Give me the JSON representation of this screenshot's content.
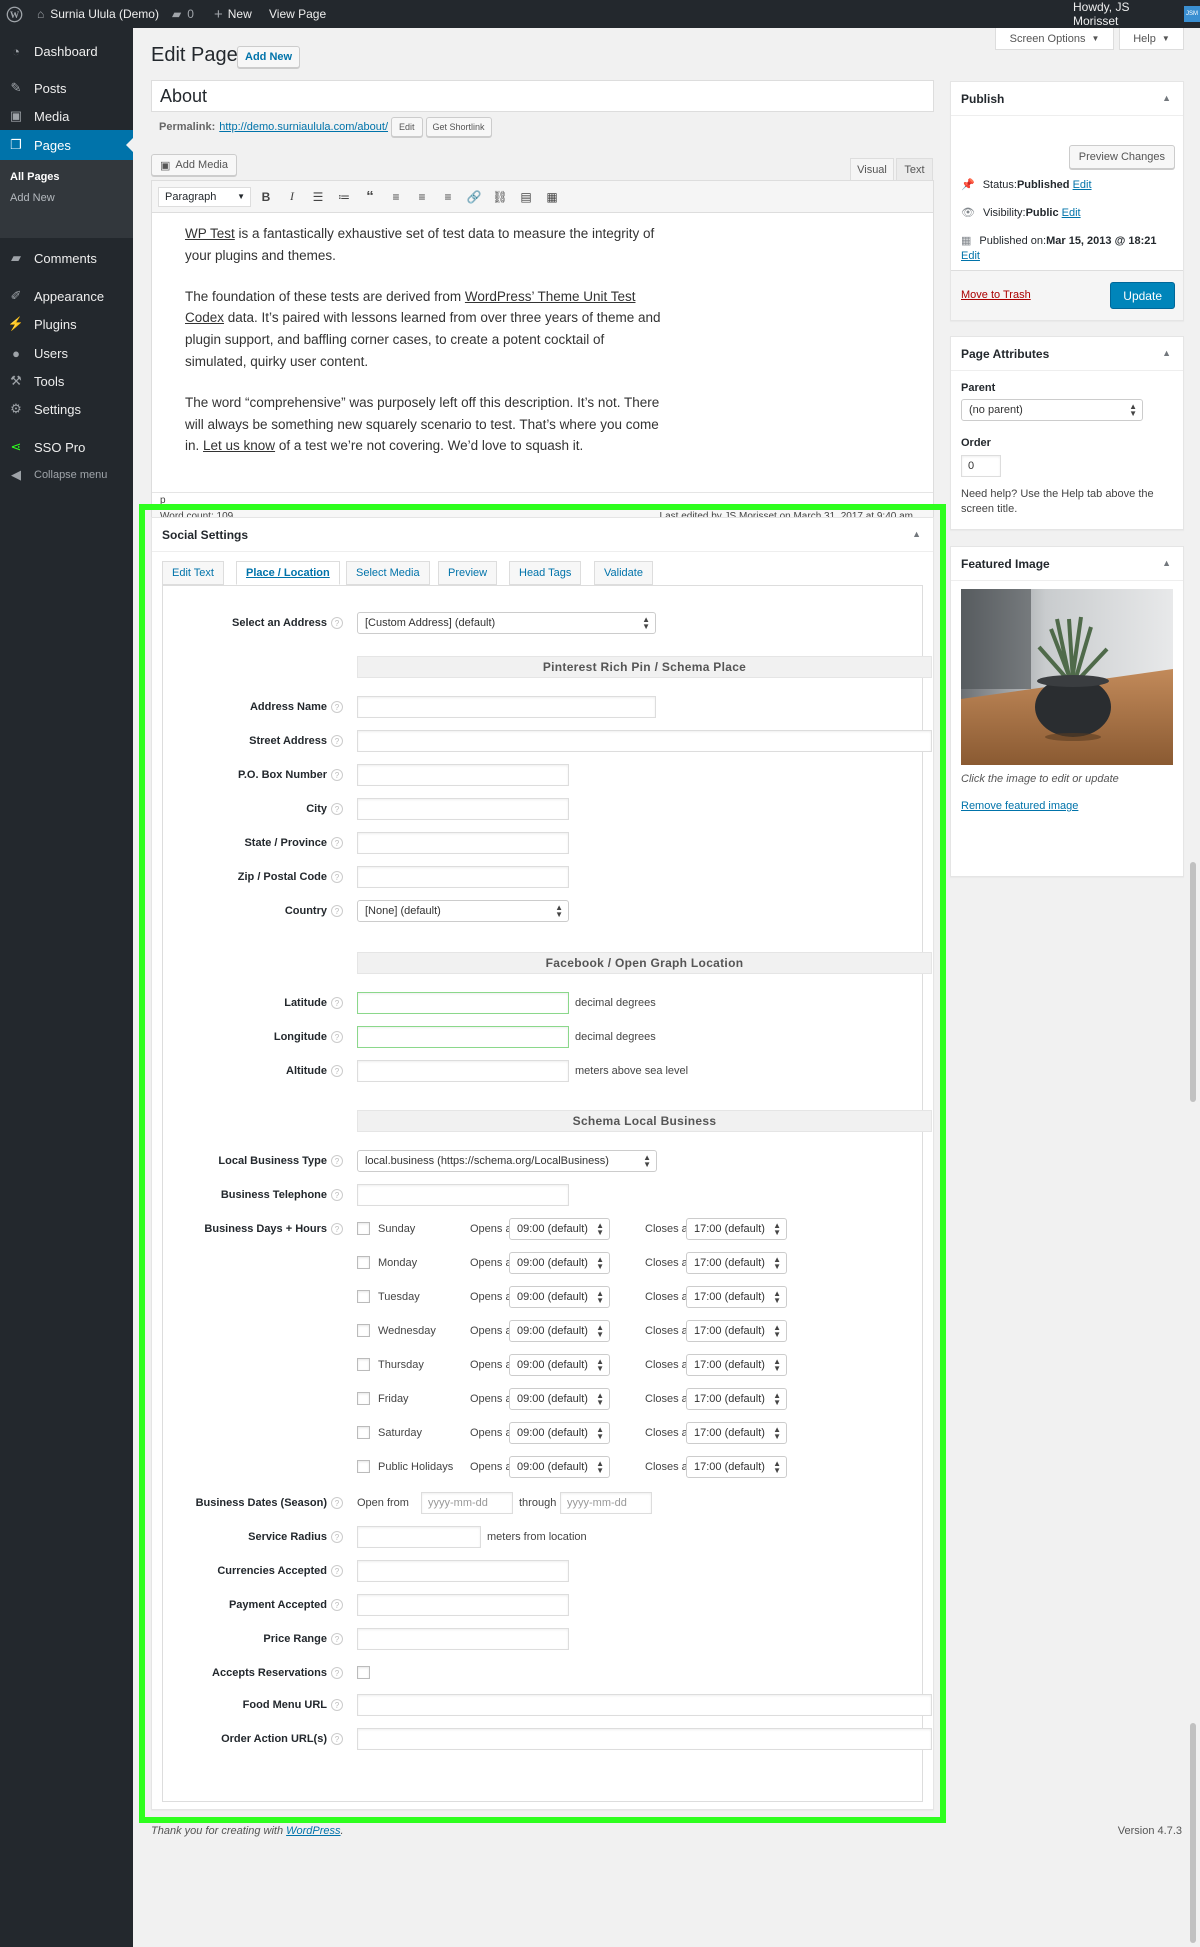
{
  "adminbar": {
    "site_name": "Surnia Ulula (Demo)",
    "comments_count": "0",
    "new_label": "New",
    "view_page": "View Page",
    "howdy": "Howdy, JS Morisset",
    "avatar": "JSM"
  },
  "menu": {
    "dashboard": "Dashboard",
    "posts": "Posts",
    "media": "Media",
    "pages": "Pages",
    "all_pages": "All Pages",
    "add_new": "Add New",
    "comments": "Comments",
    "appearance": "Appearance",
    "plugins": "Plugins",
    "users": "Users",
    "tools": "Tools",
    "settings": "Settings",
    "sso_pro": "SSO Pro",
    "collapse": "Collapse menu"
  },
  "screen_options": "Screen Options",
  "help": "Help",
  "page_title": "Edit Page",
  "add_new_button": "Add New",
  "post_title": "About",
  "permalink": {
    "label": "Permalink:",
    "url": "http://demo.surniaulula.com/about/",
    "edit": "Edit",
    "shortlink": "Get Shortlink"
  },
  "editor": {
    "add_media": "Add Media",
    "visual_tab": "Visual",
    "text_tab": "Text",
    "format": "Paragraph",
    "p1a": "WP Test",
    "p1b": " is a fantastically exhaustive set of test data to measure the integrity of your plugins and themes.",
    "p2a": "The foundation of these tests are derived from ",
    "p2b": "WordPress’ Theme Unit Test Codex",
    "p2c": " data. It’s paired with lessons learned from over three years of theme and plugin support, and baffling corner cases, to create a potent cocktail of simulated, quirky user content.",
    "p3a": "The word “comprehensive” was purposely left off this description. It’s not. There will always be something new squarely scenario to test. That’s where you come in. ",
    "p3b": "Let us know",
    "p3c": " of a test we’re not covering. We’d love to squash it.",
    "path": "p",
    "word_count": "Word count: 109",
    "last_edited": "Last edited by JS Morisset on March 31, 2017 at 9:40 am"
  },
  "social": {
    "title": "Social Settings",
    "tabs": [
      "Edit Text",
      "Place / Location",
      "Select Media",
      "Preview",
      "Head Tags",
      "Validate"
    ],
    "select_address_label": "Select an Address",
    "select_address_value": "[Custom Address] (default)",
    "pinterest_heading": "Pinterest Rich Pin / Schema Place",
    "address_name": "Address Name",
    "street_address": "Street Address",
    "po_box": "P.O. Box Number",
    "city": "City",
    "state": "State / Province",
    "zip": "Zip / Postal Code",
    "country": "Country",
    "country_value": "[None] (default)",
    "facebook_heading": "Facebook / Open Graph Location",
    "latitude": "Latitude",
    "longitude": "Longitude",
    "altitude": "Altitude",
    "decimal_degrees": "decimal degrees",
    "meters_sea": "meters above sea level",
    "schema_heading": "Schema Local Business",
    "lb_type": "Local Business Type",
    "lb_type_value": "local.business (https://schema.org/LocalBusiness)",
    "telephone": "Business Telephone",
    "days_hours": "Business Days + Hours",
    "opens_at": "Opens at",
    "closes_at": "Closes at",
    "opens_value": "09:00 (default)",
    "closes_value": "17:00 (default)",
    "days": [
      "Sunday",
      "Monday",
      "Tuesday",
      "Wednesday",
      "Thursday",
      "Friday",
      "Saturday",
      "Public Holidays"
    ],
    "dates_season": "Business Dates (Season)",
    "open_from": "Open from",
    "through": "through",
    "date_placeholder": "yyyy-mm-dd",
    "service_radius": "Service Radius",
    "meters_location": "meters from location",
    "currencies": "Currencies Accepted",
    "payment": "Payment Accepted",
    "price_range": "Price Range",
    "reservations": "Accepts Reservations",
    "food_menu": "Food Menu URL",
    "order_action": "Order Action URL(s)"
  },
  "publish": {
    "title": "Publish",
    "preview": "Preview Changes",
    "status_label": "Status: ",
    "status": "Published",
    "visibility_label": "Visibility: ",
    "visibility": "Public",
    "published_on_label": "Published on: ",
    "published_on": "Mar 15, 2013 @ 18:21",
    "edit": "Edit",
    "trash": "Move to Trash",
    "update": "Update"
  },
  "attributes": {
    "title": "Page Attributes",
    "parent_label": "Parent",
    "parent_value": "(no parent)",
    "order_label": "Order",
    "order_value": "0",
    "help": "Need help? Use the Help tab above the screen title."
  },
  "featured": {
    "title": "Featured Image",
    "caption": "Click the image to edit or update",
    "remove": "Remove featured image"
  },
  "footer": {
    "thanks": "Thank you for creating with ",
    "wp": "WordPress",
    "dot": ".",
    "version": "Version 4.7.3"
  },
  "colors": {
    "highlight": "#2eff1e",
    "primary": "#0073aa",
    "adminbar": "#23282d"
  }
}
